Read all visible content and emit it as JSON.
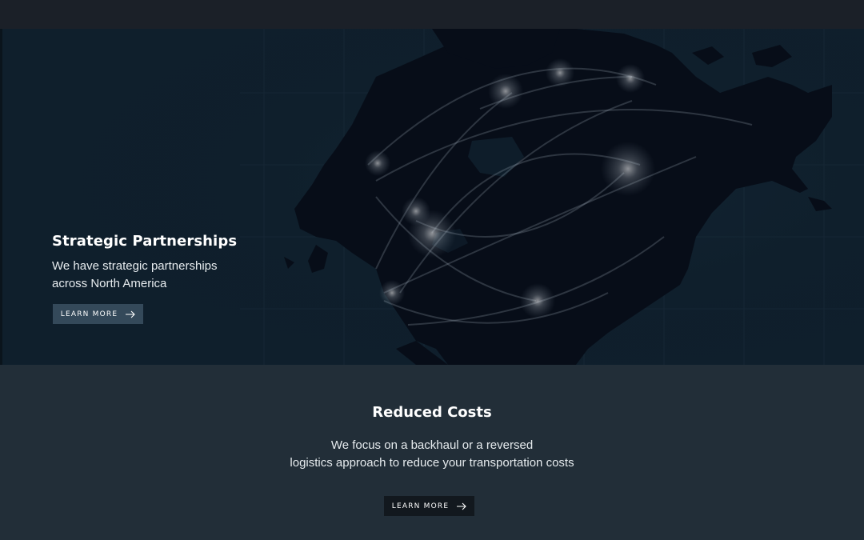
{
  "hero": {
    "title": "Strategic Partnerships",
    "description_line1": "We have strategic partnerships",
    "description_line2": "across North America",
    "button_label": "LEARN MORE",
    "button_icon": "arrow-right-icon"
  },
  "lower": {
    "title": "Reduced Costs",
    "description_line1": "We focus on a backhaul or a reversed",
    "description_line2": "logistics approach to reduce your transportation costs",
    "button_label": "LEARN MORE",
    "button_icon": "arrow-right-icon"
  },
  "colors": {
    "topbar": "#1b2028",
    "hero_background": "#0f1f2c",
    "land": "#070d18",
    "hero_button": "#34495a",
    "lower_background": "#222e38",
    "lower_button": "#12181e"
  }
}
